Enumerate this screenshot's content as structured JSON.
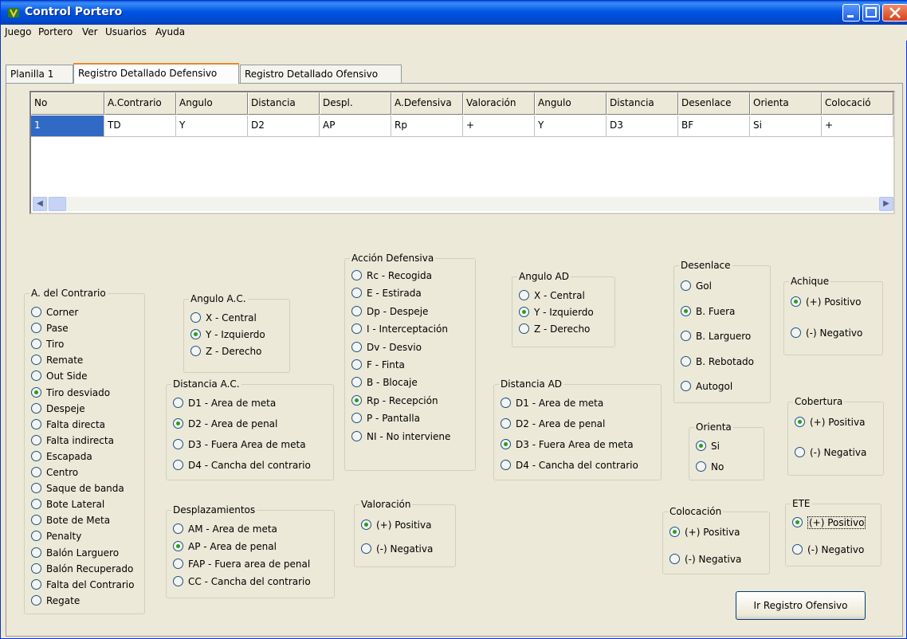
{
  "window": {
    "title": "Control Portero"
  },
  "menu": [
    "Juego",
    "Portero",
    "Ver",
    "Usuarios",
    "Ayuda"
  ],
  "tabs": [
    "Planilla 1",
    "Registro Detallado Defensivo",
    "Registro  Detallado Ofensivo"
  ],
  "grid": {
    "columns": [
      "No",
      "A.Contrario",
      "Angulo",
      "Distancia",
      "Despl.",
      "A.Defensiva",
      "Valoración",
      "Angulo",
      "Distancia",
      "Desenlace",
      "Orienta",
      "Colocació"
    ],
    "rows": [
      [
        "1",
        "TD",
        "Y",
        "D2",
        "AP",
        "Rp",
        "+",
        "Y",
        "D3",
        "BF",
        "Si",
        "+"
      ]
    ]
  },
  "groups": {
    "contrario": {
      "legend": "A. del Contrario",
      "selected": 5,
      "options": [
        "Corner",
        "Pase",
        "Tiro",
        "Remate",
        "Out Side",
        "Tiro desviado",
        "Despeje",
        "Falta directa",
        "Falta indirecta",
        "Escapada",
        "Centro",
        "Saque de banda",
        "Bote Lateral",
        "Bote de Meta",
        "Penalty",
        "Balón Larguero",
        "Balón Recuperado",
        "Falta del Contrario",
        "Regate"
      ]
    },
    "angulo_ac": {
      "legend": "Angulo A.C.",
      "selected": 1,
      "options": [
        "X - Central",
        "Y - Izquierdo",
        "Z - Derecho"
      ]
    },
    "distancia_ac": {
      "legend": "Distancia A.C.",
      "selected": 1,
      "options": [
        "D1 - Area de meta",
        "D2 - Area de penal",
        "D3 - Fuera Area de meta",
        "D4 - Cancha del contrario"
      ]
    },
    "desplazamientos": {
      "legend": "Desplazamientos",
      "selected": 1,
      "options": [
        "AM  - Area de meta",
        "AP  - Area de penal",
        "FAP - Fuera area de penal",
        "CC  - Cancha del contrario"
      ]
    },
    "accion_defensiva": {
      "legend": "Acción Defensiva",
      "selected": 7,
      "options": [
        "Rc  - Recogida",
        "E   - Estirada",
        "Dp  - Despeje",
        "I    - Interceptación",
        "Dv  - Desvio",
        "F   - Finta",
        "B   - Blocaje",
        "Rp  - Recepción",
        "P   - Pantalla",
        "NI  - No interviene"
      ]
    },
    "valoracion": {
      "legend": "Valoración",
      "selected": 0,
      "options": [
        "(+) Positiva",
        "(-) Negativa"
      ]
    },
    "angulo_ad": {
      "legend": "Angulo AD",
      "selected": 1,
      "options": [
        "X - Central",
        "Y - Izquierdo",
        "Z - Derecho"
      ]
    },
    "distancia_ad": {
      "legend": "Distancia AD",
      "selected": 2,
      "options": [
        "D1 - Area de meta",
        "D2 - Area de penal",
        "D3 - Fuera Area de meta",
        "D4 - Cancha del contrario"
      ]
    },
    "desenlace": {
      "legend": "Desenlace",
      "selected": 1,
      "options": [
        "Gol",
        "B. Fuera",
        "B. Larguero",
        "B. Rebotado",
        "Autogol"
      ]
    },
    "achique": {
      "legend": "Achique",
      "selected": 0,
      "options": [
        "(+) Positivo",
        "(-)  Negativo"
      ]
    },
    "cobertura": {
      "legend": "Cobertura",
      "selected": 0,
      "options": [
        "(+) Positiva",
        "(-)  Negativa"
      ]
    },
    "orienta": {
      "legend": "Orienta",
      "selected": 0,
      "options": [
        "Si",
        "No"
      ]
    },
    "colocacion": {
      "legend": "Colocación",
      "selected": 0,
      "options": [
        "(+) Positiva",
        "(-)  Negativa"
      ]
    },
    "ete": {
      "legend": "ETE",
      "selected": 0,
      "options": [
        "(+) Positivo",
        "(-)  Negativo"
      ]
    }
  },
  "buttons": {
    "ir_ofensivo": "Ir Registro Ofensivo"
  }
}
